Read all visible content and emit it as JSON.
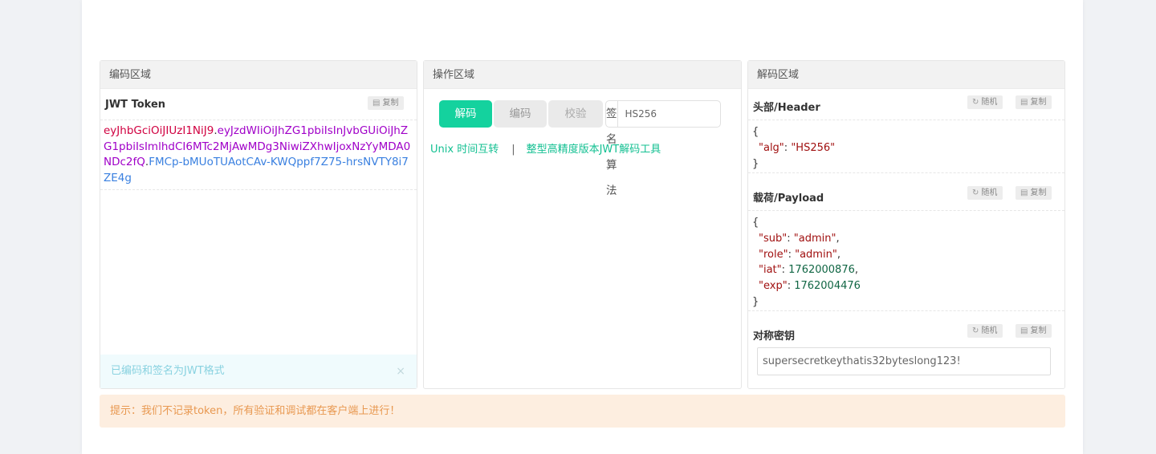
{
  "encode_panel": {
    "title": "编码区域",
    "token_label": "JWT Token",
    "copy_label": "复制",
    "token_header": "eyJhbGciOiJIUzI1NiJ9",
    "token_payload": "eyJzdWIiOiJhZG1pbiIsInJvbGUiOiJhZG1pbiIsImlhdCI6MTc2MjAwMDg3NiwiZXhwIjoxNzYyMDA0NDc2fQ",
    "token_signature": "FMCp-bMUoTUAotCAv-KWQppf7Z75-hrsNVTY8i7ZE4g",
    "dot": ".",
    "status_message": "已编码和签名为JWT格式",
    "close_symbol": "×"
  },
  "operation_panel": {
    "title": "操作区域",
    "decode_label": "解码",
    "encode_label": "编码",
    "verify_label": "校验",
    "algorithm_label": "签名算法",
    "algorithm_value": "HS256",
    "link_unix": "Unix 时间互转",
    "link_separator": "|",
    "link_bigint": "整型高精度版本JWT解码工具"
  },
  "decode_panel": {
    "title": "解码区域",
    "random_label": "随机",
    "copy_label": "复制",
    "header_label": "头部/Header",
    "header_json": {
      "open": "{",
      "close": "}",
      "alg_key": "\"alg\"",
      "alg_value": "\"HS256\""
    },
    "payload_label": "载荷/Payload",
    "payload_json": {
      "open": "{",
      "close": "}",
      "sub_key": "\"sub\"",
      "sub_value": "\"admin\"",
      "role_key": "\"role\"",
      "role_value": "\"admin\"",
      "iat_key": "\"iat\"",
      "iat_value": "1762000876",
      "exp_key": "\"exp\"",
      "exp_value": "1762004476"
    },
    "secret_label": "对称密钥",
    "secret_value": "supersecretkeythatis32byteslong123!"
  },
  "tip": "提示：我们不记录token，所有验证和调试都在客户端上进行！",
  "colors": {
    "accent": "#14d29e",
    "token_header": "#d00040",
    "token_payload": "#a000c8",
    "token_signature": "#3a80e0",
    "tip_text": "#e89850",
    "tip_bg": "#fdeee0"
  },
  "icons": {
    "copy": "clipboard-icon",
    "random": "refresh-icon",
    "close": "close-icon"
  }
}
